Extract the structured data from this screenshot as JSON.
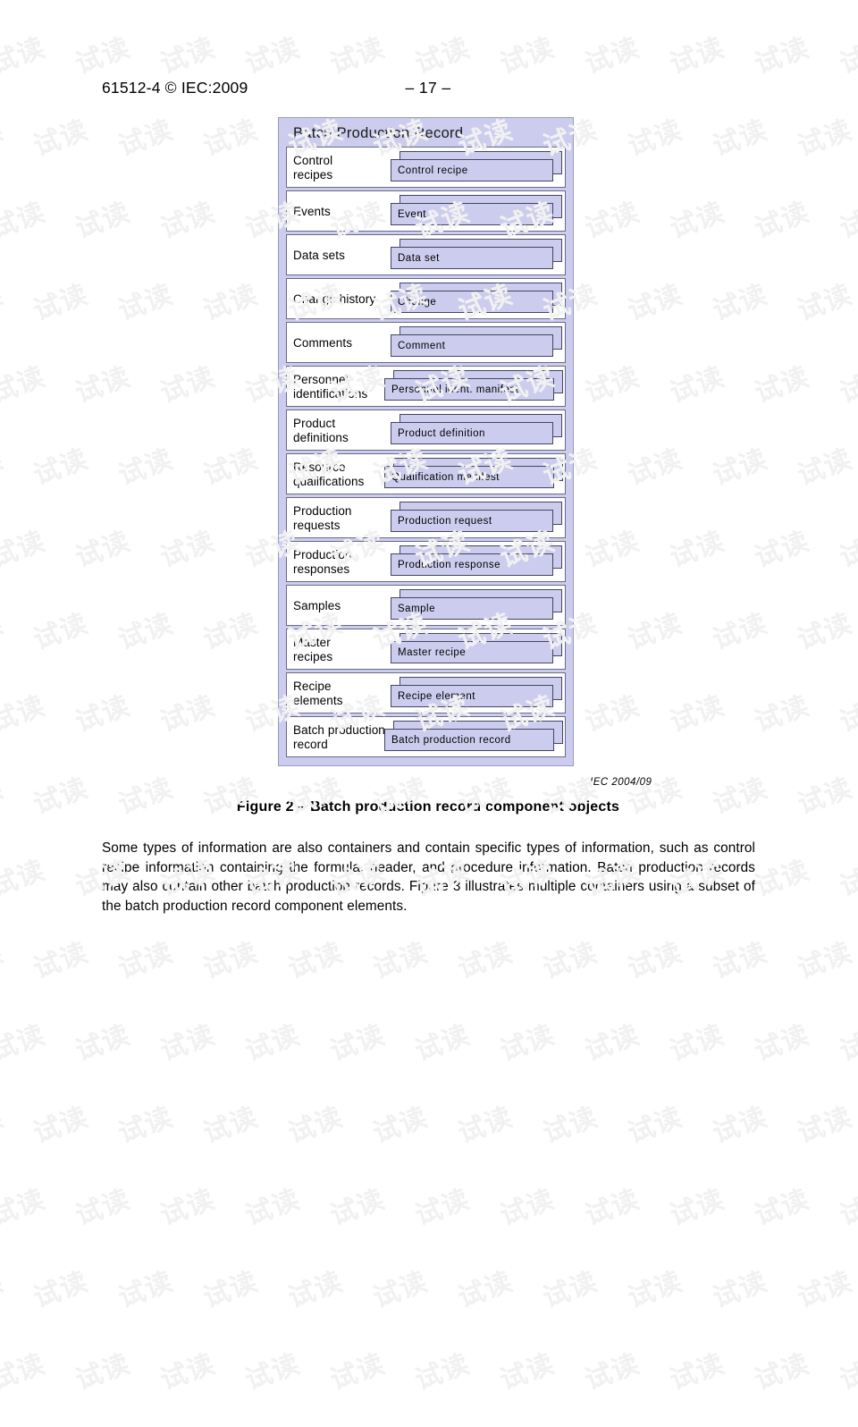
{
  "header": {
    "left": "61512-4 © IEC:2009",
    "page_number": "– 17 –"
  },
  "figure": {
    "title": "Batch Production Record",
    "credit": "IEC   2004/09",
    "caption": "Figure 2 – Batch production record component objects",
    "outer_fill": "#ccccee",
    "row_fill": "#ffffff",
    "nested_fill": "#ccccee",
    "rows": [
      {
        "label_line1": "Control",
        "label_line2": "recipes",
        "object": "Control recipe"
      },
      {
        "label_line1": "Events",
        "label_line2": "",
        "object": "Event"
      },
      {
        "label_line1": "Data sets",
        "label_line2": "",
        "object": "Data set"
      },
      {
        "label_line1": "Change history",
        "label_line2": "",
        "object": "Change"
      },
      {
        "label_line1": "Comments",
        "label_line2": "",
        "object": "Comment"
      },
      {
        "label_line1": "Personnel",
        "label_line2": "identifications",
        "object": "Personnel ident. manifest"
      },
      {
        "label_line1": "Product",
        "label_line2": "definitions",
        "object": "Product definition"
      },
      {
        "label_line1": "Resource",
        "label_line2": "qualifications",
        "object": "Qualification manifest"
      },
      {
        "label_line1": "Production",
        "label_line2": "requests",
        "object": "Production request"
      },
      {
        "label_line1": "Production",
        "label_line2": "responses",
        "object": "Production response"
      },
      {
        "label_line1": "Samples",
        "label_line2": "",
        "object": "Sample"
      },
      {
        "label_line1": "Master",
        "label_line2": "recipes",
        "object": "Master recipe"
      },
      {
        "label_line1": "Recipe",
        "label_line2": "elements",
        "object": "Recipe element"
      },
      {
        "label_line1": "Batch production",
        "label_line2": "record",
        "object": "Batch production record"
      }
    ]
  },
  "body": {
    "paragraph": "Some types of information are also containers and contain specific types of information, such as control recipe information containing the formula, header, and procedure information. Batch production records may also contain other batch production records. Figure 3 illustrates multiple containers using a subset of the batch production record component elements."
  },
  "watermark": {
    "text": "试读"
  }
}
